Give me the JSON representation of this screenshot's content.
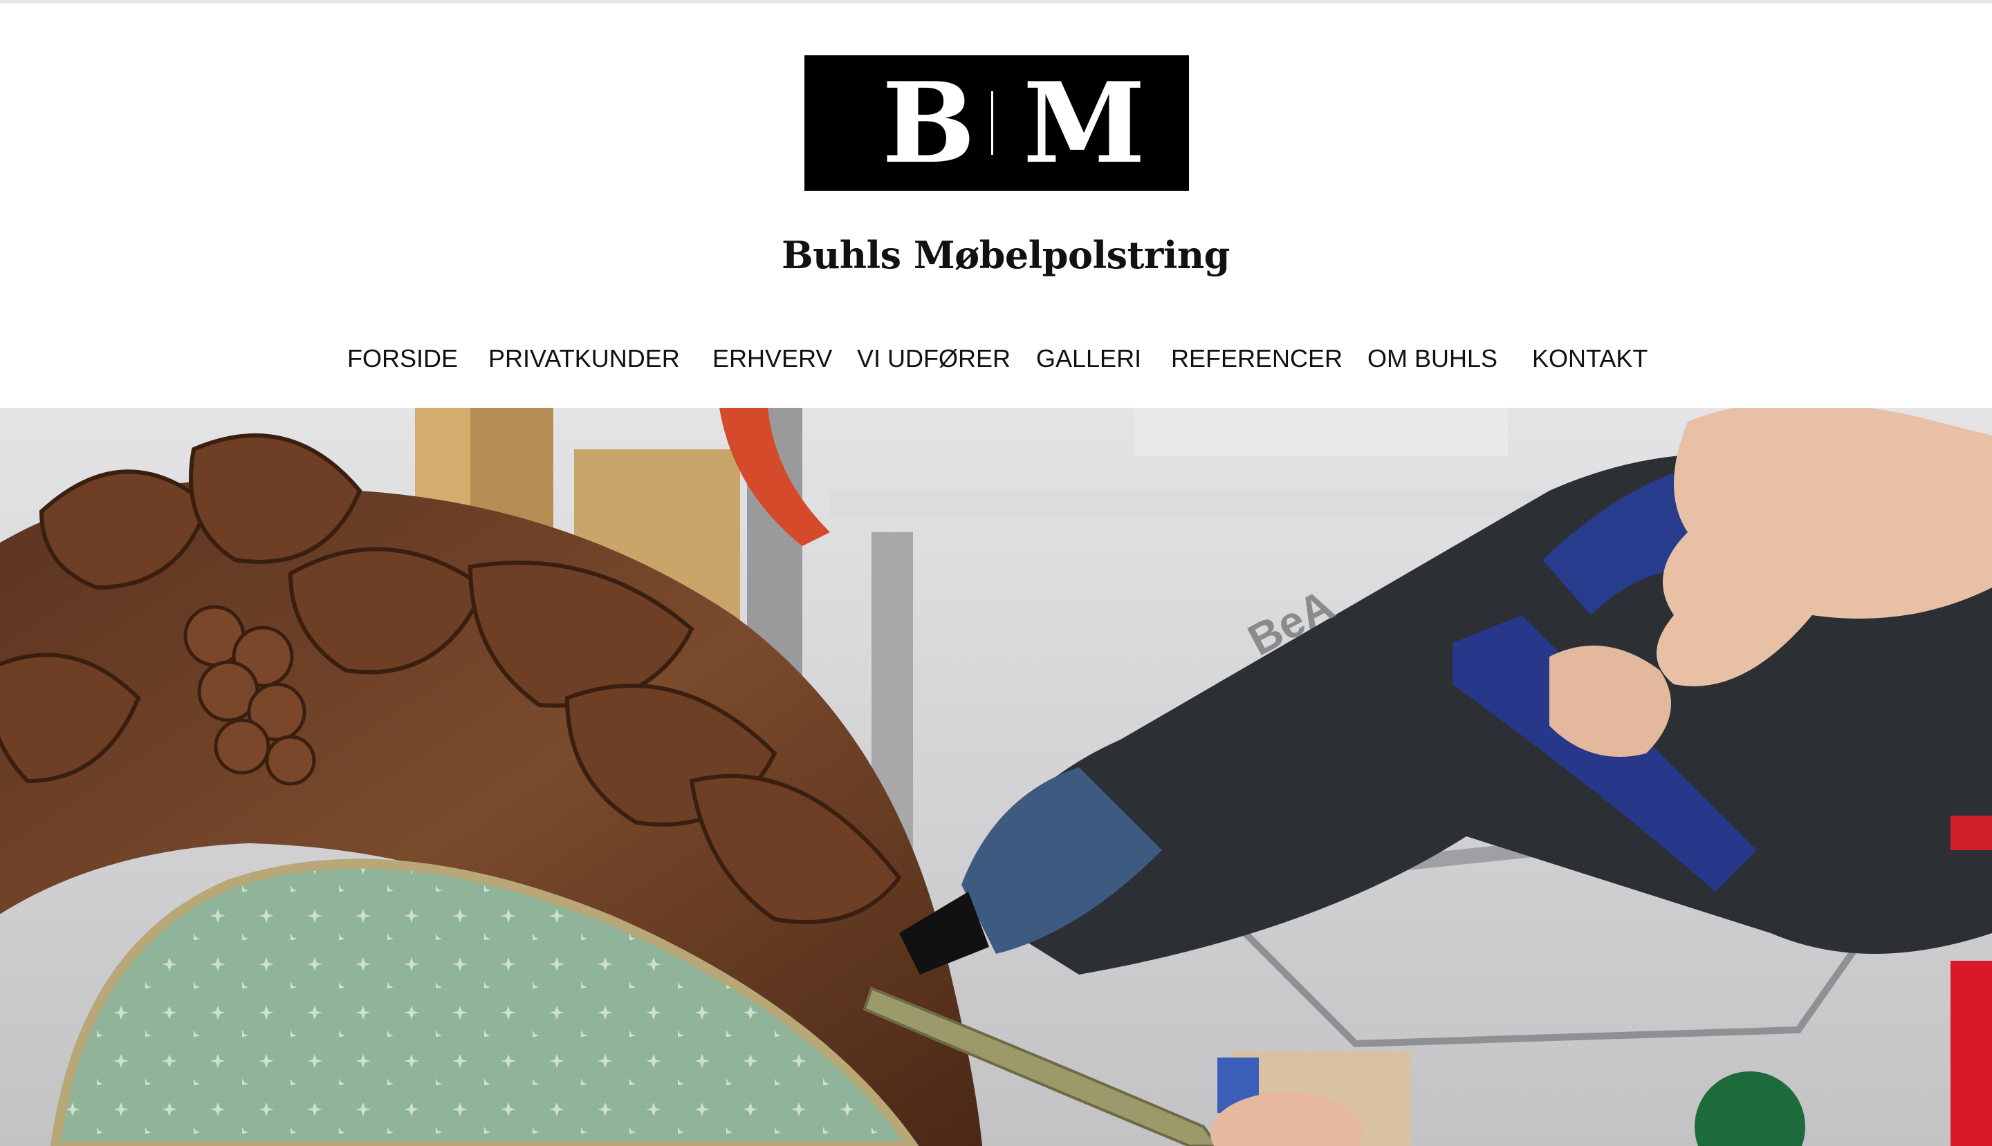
{
  "brand": {
    "logo_letters": [
      "B",
      "M"
    ],
    "name": "Buhls Møbelpolstring"
  },
  "nav": {
    "items": [
      {
        "label": "FORSIDE"
      },
      {
        "label": "PRIVATKUNDER"
      },
      {
        "label": "ERHVERV"
      },
      {
        "label": "VI UDFØRER"
      },
      {
        "label": "GALLERI"
      },
      {
        "label": "REFERENCER"
      },
      {
        "label": "OM BUHLS"
      },
      {
        "label": "KONTAKT"
      }
    ]
  },
  "hero": {
    "tool_brand_text": "BeA"
  },
  "colors": {
    "background": "#ffffff",
    "text": "#111111",
    "logo_box": "#000000",
    "logo_text": "#ffffff"
  }
}
